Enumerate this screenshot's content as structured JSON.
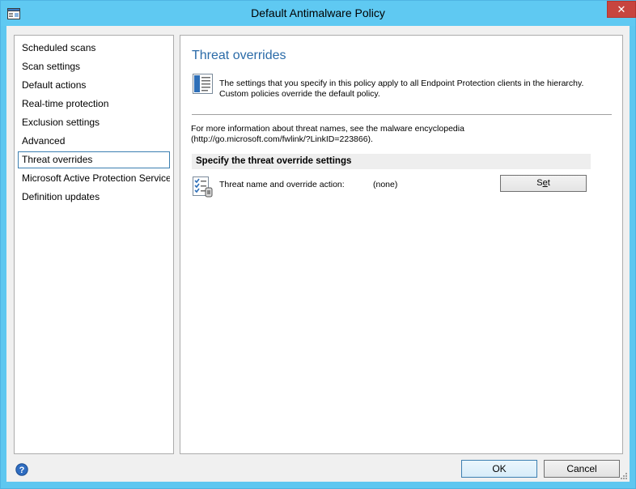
{
  "window": {
    "title": "Default Antimalware Policy",
    "close_glyph": "✕"
  },
  "nav": {
    "items": [
      {
        "label": "Scheduled scans",
        "selected": false
      },
      {
        "label": "Scan settings",
        "selected": false
      },
      {
        "label": "Default actions",
        "selected": false
      },
      {
        "label": "Real-time protection",
        "selected": false
      },
      {
        "label": "Exclusion settings",
        "selected": false
      },
      {
        "label": "Advanced",
        "selected": false
      },
      {
        "label": "Threat overrides",
        "selected": true
      },
      {
        "label": "Microsoft Active Protection Service",
        "selected": false
      },
      {
        "label": "Definition updates",
        "selected": false
      }
    ]
  },
  "content": {
    "title": "Threat overrides",
    "info_line_1": "The settings that you specify in this policy apply to all Endpoint Protection clients in the hierarchy.",
    "info_line_2": "Custom policies override the default policy.",
    "encyclopedia_line_1": "For more information about threat names, see the malware encyclopedia",
    "encyclopedia_line_2": "(http://go.microsoft.com/fwlink/?LinkID=223866).",
    "section_header": "Specify the threat override settings",
    "setting_label": "Threat name and override action:",
    "setting_value": "(none)",
    "set_button_prefix": "S",
    "set_button_underlined": "e",
    "set_button_suffix": "t"
  },
  "footer": {
    "ok_label": "OK",
    "cancel_label": "Cancel"
  },
  "icons": {
    "app": "policy-window-icon",
    "close": "close-icon",
    "info": "document-info-icon",
    "setting": "checklist-icon",
    "help": "help-icon",
    "grip": "resize-grip-icon"
  },
  "colors": {
    "titlebar": "#5fc9f2",
    "close_button": "#c7453f",
    "title_accent": "#2b6ba8",
    "selection_border": "#3c7fb1"
  }
}
